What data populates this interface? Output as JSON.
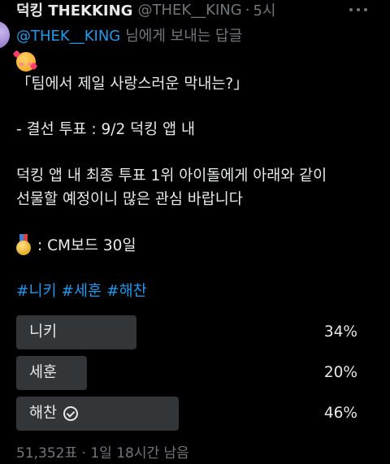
{
  "header": {
    "name": "덕킹 THEKKING",
    "handle": "@THEK__KING",
    "separator": "·",
    "time": "5시"
  },
  "reply": {
    "mention": "@THEK__KING",
    "suffix": "님에게 보내는 답글"
  },
  "body": {
    "line1": "「팀에서 제일 사랑스러운 막내는?」",
    "line2": "- 결선 투표 : 9/2 덕킹 앱 내",
    "line3": "덕킹 앱 내 최종 투표 1위 아이돌에게 아래와 같이",
    "line4": "선물할 예정이니 많은 관심 바랍니다",
    "line5": ": CM보드 30일"
  },
  "hashtags": [
    "#니키",
    "#세훈",
    "#해찬"
  ],
  "icons": {
    "face": "smiling-face-with-hearts-icon",
    "medal": "gold-medal-icon",
    "more": "more-options-icon",
    "winner": "check-circle-icon"
  },
  "poll": {
    "options": [
      {
        "label": "니키",
        "percent_text": "34%",
        "percent": 34,
        "winner": false
      },
      {
        "label": "세훈",
        "percent_text": "20%",
        "percent": 20,
        "winner": false
      },
      {
        "label": "해찬",
        "percent_text": "46%",
        "percent": 46,
        "winner": true
      }
    ],
    "footer": "51,352표 · 1일 18시간 남음"
  },
  "colors": {
    "background": "#000000",
    "text": "#e7e9ea",
    "secondary": "#71767b",
    "link": "#1d9bf0",
    "poll_bar": "#333639"
  }
}
